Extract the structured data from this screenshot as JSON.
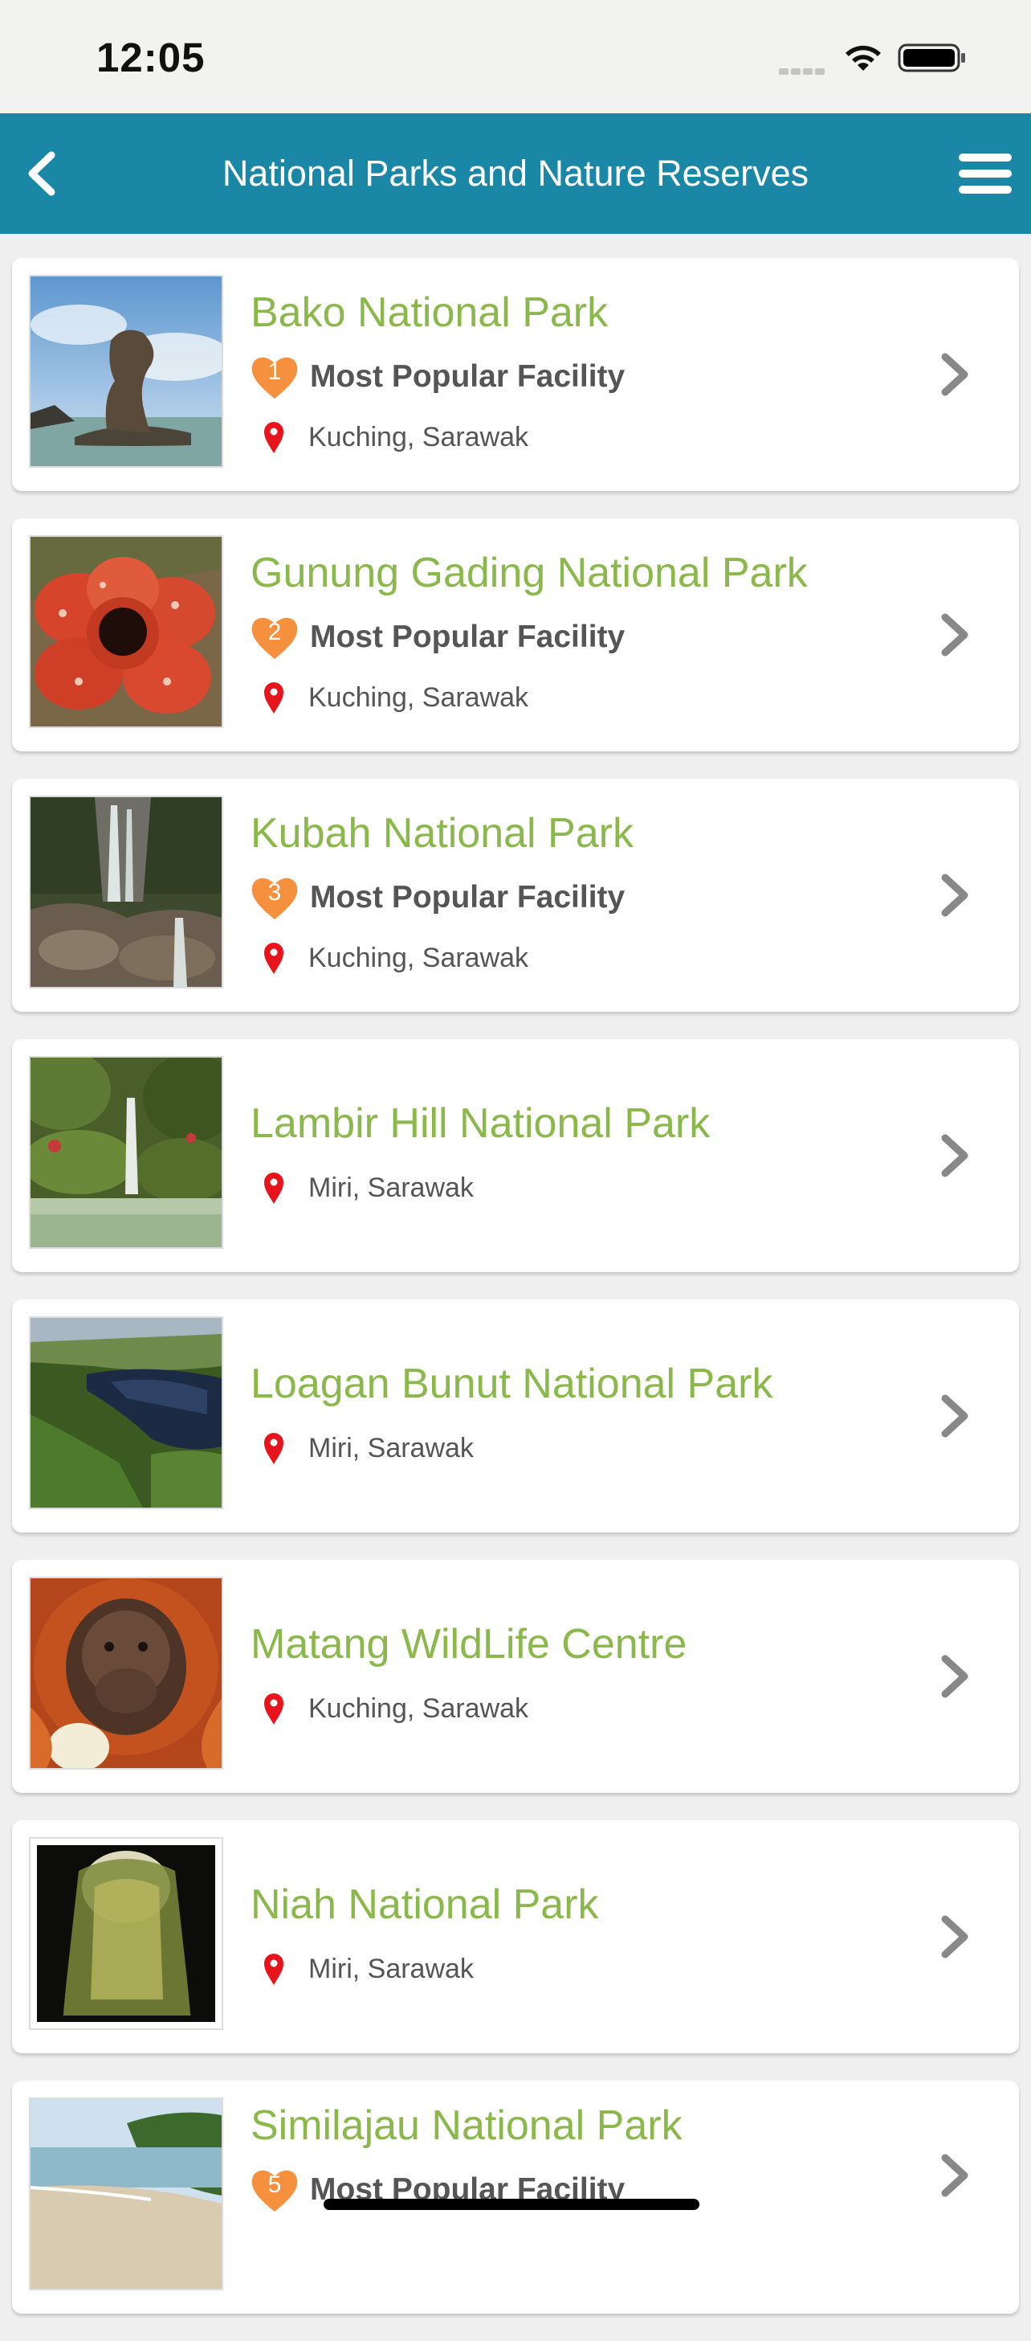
{
  "status_bar": {
    "time": "12:05"
  },
  "nav": {
    "title": "National Parks and Nature Reserves",
    "back_icon": "chevron-left-icon",
    "menu_icon": "hamburger-menu-icon"
  },
  "colors": {
    "nav_background": "#1b87a6",
    "park_name": "#8bb84a",
    "rank_badge": "#f5913e",
    "location_pin": "#e8141c"
  },
  "parks": [
    {
      "name": "Bako National Park",
      "rank": "1",
      "popular_label": "Most Popular Facility",
      "location": "Kuching, Sarawak",
      "thumbnail": "sea-stack-rock-photo"
    },
    {
      "name": "Gunung Gading National Park",
      "rank": "2",
      "popular_label": "Most Popular Facility",
      "location": "Kuching, Sarawak",
      "thumbnail": "rafflesia-flower-photo"
    },
    {
      "name": "Kubah National Park",
      "rank": "3",
      "popular_label": "Most Popular Facility",
      "location": "Kuching, Sarawak",
      "thumbnail": "rocky-waterfall-photo"
    },
    {
      "name": "Lambir Hill National Park",
      "location": "Miri, Sarawak",
      "thumbnail": "jungle-waterfall-pool-photo"
    },
    {
      "name": "Loagan Bunut National Park",
      "location": "Miri, Sarawak",
      "thumbnail": "aerial-lake-forest-photo"
    },
    {
      "name": "Matang WildLife Centre",
      "location": "Kuching, Sarawak",
      "thumbnail": "orangutan-photo"
    },
    {
      "name": "Niah National Park",
      "location": "Miri, Sarawak",
      "thumbnail": "cave-entrance-photo"
    },
    {
      "name": "Similajau National Park",
      "rank": "5",
      "popular_label": "Most Popular Facility",
      "location": "",
      "thumbnail": "beach-coast-photo"
    }
  ]
}
